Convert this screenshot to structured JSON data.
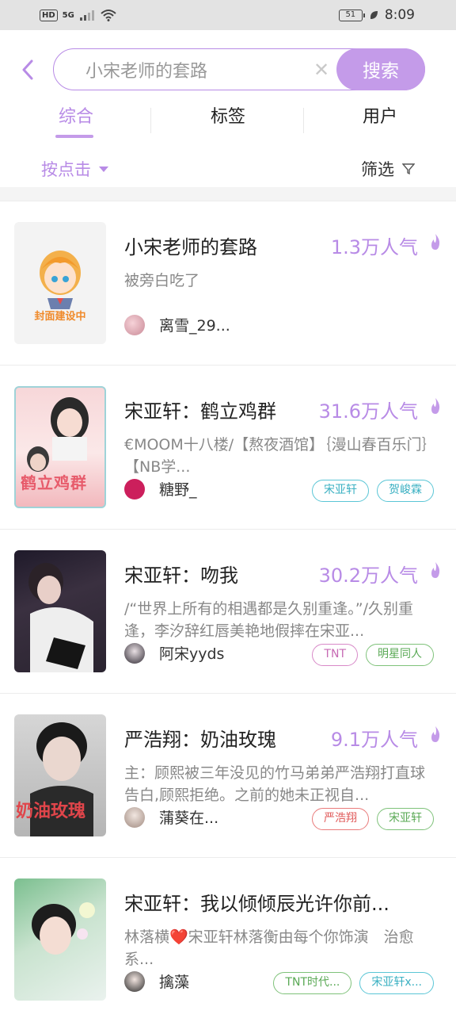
{
  "status": {
    "network": "5G",
    "hd": "HD",
    "battery": "51",
    "time": "8:09"
  },
  "search": {
    "query": "小宋老师的套路",
    "button": "搜索"
  },
  "tabs": [
    "综合",
    "标签",
    "用户"
  ],
  "sort": {
    "label": "按点击",
    "filter": "筛选"
  },
  "colors": {
    "accent": "#b88be6",
    "button": "#c49be9",
    "muted": "#888888"
  },
  "results": [
    {
      "title": "小宋老师的套路",
      "popularity": "1.3万人气",
      "desc": "被旁白吃了",
      "author": "离雪_29...",
      "cover_text": "封面建设中",
      "tags": []
    },
    {
      "title": "宋亚轩：鹤立鸡群",
      "popularity": "31.6万人气",
      "desc": "€MOOM十八楼/【熬夜酒馆】｛漫山春百乐门｝【NB学...",
      "author": "糖野_",
      "cover_text": "鹤立鸡群",
      "tags": [
        {
          "label": "宋亚轩",
          "color": "#5bc6d6"
        },
        {
          "label": "贺峻霖",
          "color": "#5bc6d6"
        }
      ]
    },
    {
      "title": "宋亚轩：吻我",
      "popularity": "30.2万人气",
      "desc": "/“世界上所有的相遇都是久别重逢。”/久别重逢，李汐辞红唇美艳地假摔在宋亚...",
      "author": "阿宋yyds",
      "cover_text": "",
      "tags": [
        {
          "label": "TNT",
          "color": "#d889c8"
        },
        {
          "label": "明星同人",
          "color": "#7fc27a"
        }
      ]
    },
    {
      "title": "严浩翔：奶油玫瑰",
      "popularity": "9.1万人气",
      "desc": "主：顾熙被三年没见的竹马弟弟严浩翔打直球告白,顾熙拒绝。之前的她未正视自...",
      "author": "蒲葵在...",
      "cover_text": "奶油玫瑰",
      "tags": [
        {
          "label": "严浩翔",
          "color": "#e97b7b"
        },
        {
          "label": "宋亚轩",
          "color": "#7fc27a"
        }
      ]
    },
    {
      "title": "宋亚轩：我以倾倾辰光许你前...",
      "popularity": "",
      "desc": "林落横❤️宋亚轩林落衡由每个你饰演　治愈系...",
      "author": "擒藻",
      "cover_text": "",
      "tags": [
        {
          "label": "TNT时代...",
          "color": "#7fc27a"
        },
        {
          "label": "宋亚轩x...",
          "color": "#5bc6d6"
        }
      ]
    }
  ]
}
